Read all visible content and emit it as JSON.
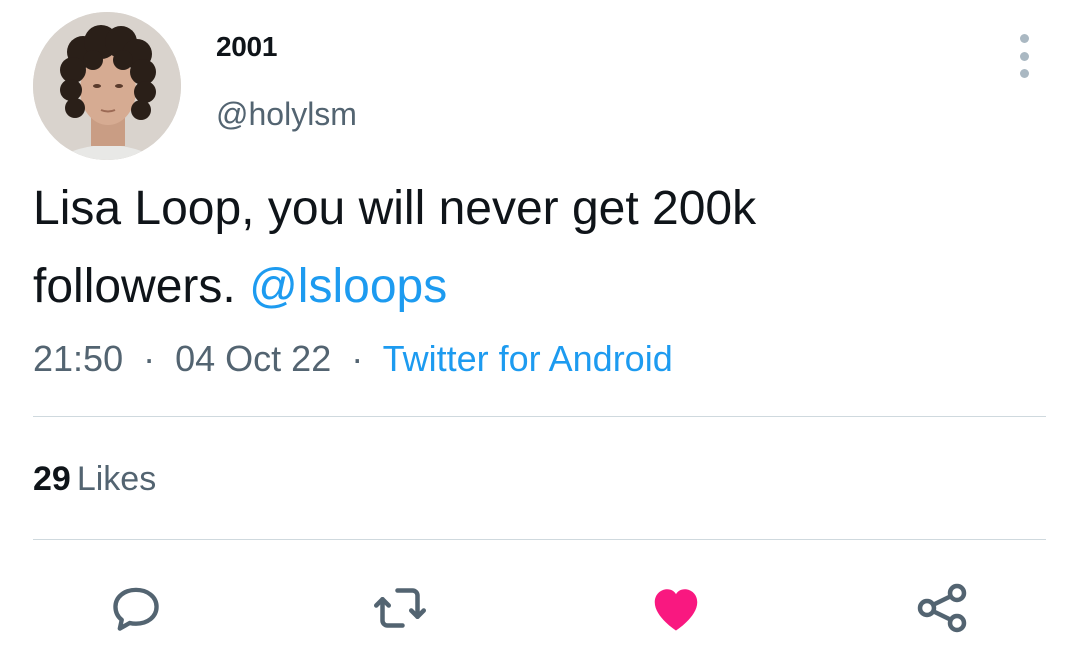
{
  "tweet": {
    "display_name": "2001",
    "handle": "@holylsm",
    "text_line1": "Lisa Loop, you will never get 200k",
    "text_line2": "followers.",
    "mention": "@lsloops",
    "time": "21:50",
    "separator": "·",
    "date": "04 Oct 22",
    "source": "Twitter for Android",
    "likes_count": "29",
    "likes_label": "Likes",
    "liked": true
  },
  "icons": {
    "more": "more-vertical-icon",
    "reply": "reply-icon",
    "retweet": "retweet-icon",
    "like": "heart-icon",
    "share": "share-icon"
  },
  "colors": {
    "link": "#1d9bf0",
    "like_active": "#f91880",
    "secondary_text": "#536471"
  }
}
